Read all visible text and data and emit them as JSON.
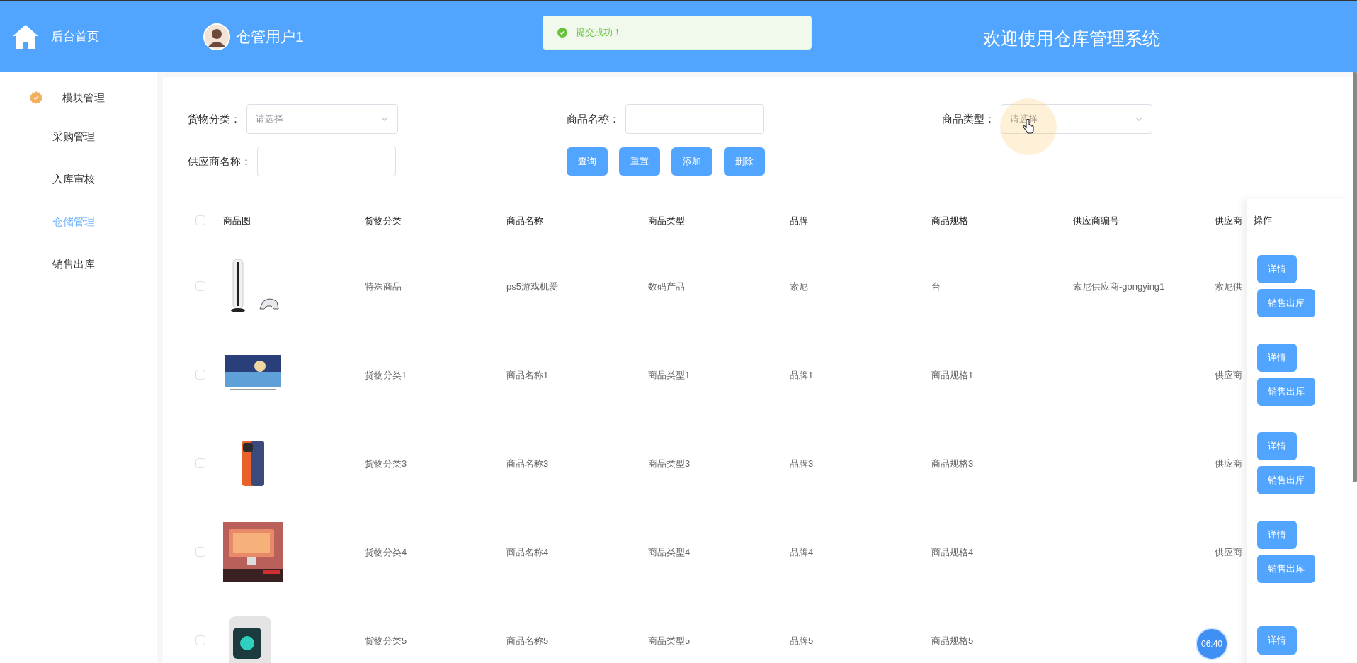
{
  "sidebar": {
    "home": "后台首页",
    "group": "模块管理",
    "items": [
      {
        "label": "采购管理",
        "selected": false
      },
      {
        "label": "入库审核",
        "selected": false
      },
      {
        "label": "仓储管理",
        "selected": true
      },
      {
        "label": "销售出库",
        "selected": false
      }
    ]
  },
  "header": {
    "user": "仓管用户1",
    "title": "欢迎使用仓库管理系统"
  },
  "toast": {
    "message": "提交成功！"
  },
  "filters": [
    {
      "label": "货物分类：",
      "kind": "select",
      "placeholder": "请选择"
    },
    {
      "label": "商品名称：",
      "kind": "input"
    },
    {
      "label": "商品类型：",
      "kind": "select",
      "placeholder": "请选择"
    },
    {
      "label": "供应商名称：",
      "kind": "input"
    }
  ],
  "actions": [
    "查询",
    "重置",
    "添加",
    "删除"
  ],
  "table": {
    "all_checked": false,
    "columns": [
      "商品图",
      "货物分类",
      "商品名称",
      "商品类型",
      "品牌",
      "商品规格",
      "供应商编号",
      "供应商"
    ],
    "action_column": "操作",
    "rows": [
      {
        "checked": false,
        "cells": [
          "",
          "特殊商品",
          "ps5游戏机爱",
          "数码产品",
          "索尼",
          "台",
          "索尼供应商-gongying1",
          "索尼供"
        ],
        "actions": [
          "详情",
          "销售出库"
        ]
      },
      {
        "checked": false,
        "cells": [
          "",
          "货物分类1",
          "商品名称1",
          "商品类型1",
          "品牌1",
          "商品规格1",
          "",
          "供应商"
        ],
        "actions": [
          "详情",
          "销售出库"
        ]
      },
      {
        "checked": false,
        "cells": [
          "",
          "货物分类3",
          "商品名称3",
          "商品类型3",
          "品牌3",
          "商品规格3",
          "",
          "供应商"
        ],
        "actions": [
          "详情",
          "销售出库"
        ]
      },
      {
        "checked": false,
        "cells": [
          "",
          "货物分类4",
          "商品名称4",
          "商品类型4",
          "品牌4",
          "商品规格4",
          "",
          "供应商"
        ],
        "actions": [
          "详情",
          "销售出库"
        ]
      },
      {
        "checked": false,
        "cells": [
          "",
          "货物分类5",
          "商品名称5",
          "商品类型5",
          "品牌5",
          "商品规格5",
          "",
          ""
        ],
        "actions": [
          "详情"
        ]
      }
    ]
  },
  "timer": "06:40"
}
